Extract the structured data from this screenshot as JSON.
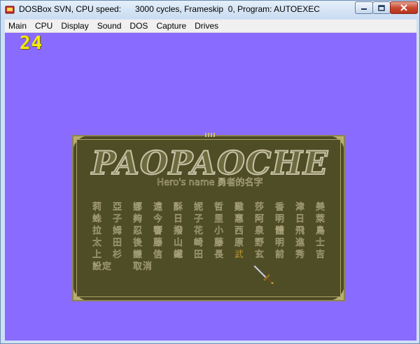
{
  "window": {
    "title": "DOSBox SVN, CPU speed:      3000 cycles, Frameskip  0, Program: AUTOEXEC",
    "controls": {
      "minimize_icon": "minimize-icon",
      "maximize_icon": "maximize-icon",
      "close_icon": "close-icon"
    }
  },
  "menu": {
    "items": [
      "Main",
      "CPU",
      "Display",
      "Sound",
      "DOS",
      "Capture",
      "Drives"
    ]
  },
  "game": {
    "fps_counter": "24",
    "logo": "PAOPAOCHE",
    "subtitle": "Hero's name 勇者的名字",
    "columns": [
      [
        "莉",
        "蛛",
        "拉",
        "太",
        "上"
      ],
      [
        "亞",
        "子",
        "姆",
        "田",
        "杉"
      ],
      [
        "娜",
        "夠",
        "忍",
        "後",
        "謙"
      ],
      [
        "遠",
        "今",
        "響",
        "藤",
        "信"
      ],
      [
        "酥",
        "日",
        "撥",
        "山",
        "鐵"
      ],
      [
        "妮",
        "子",
        "花",
        "崎",
        "田"
      ],
      [
        "哲",
        "里",
        "小",
        "藤",
        "長"
      ],
      [
        "雞",
        "惠",
        "西",
        "原",
        "武"
      ],
      [
        "莎",
        "阿",
        "泉",
        "野",
        "玄"
      ],
      [
        "香",
        "明",
        "體",
        "明",
        "前"
      ],
      [
        "津",
        "日",
        "飛",
        "進",
        "秀"
      ],
      [
        "美",
        "萊",
        "鳥",
        "士",
        "吉"
      ]
    ],
    "actions": {
      "set": "設定",
      "cancel": "取消"
    },
    "colors": {
      "background": "#8a6bff",
      "panel": "#4c4a24",
      "text": "#4d4a24",
      "text_outline": "#a9a37a",
      "selected": "#e7c84a",
      "fps": "#f1ea0a"
    },
    "cursor_icon": "sword-cursor-icon"
  }
}
